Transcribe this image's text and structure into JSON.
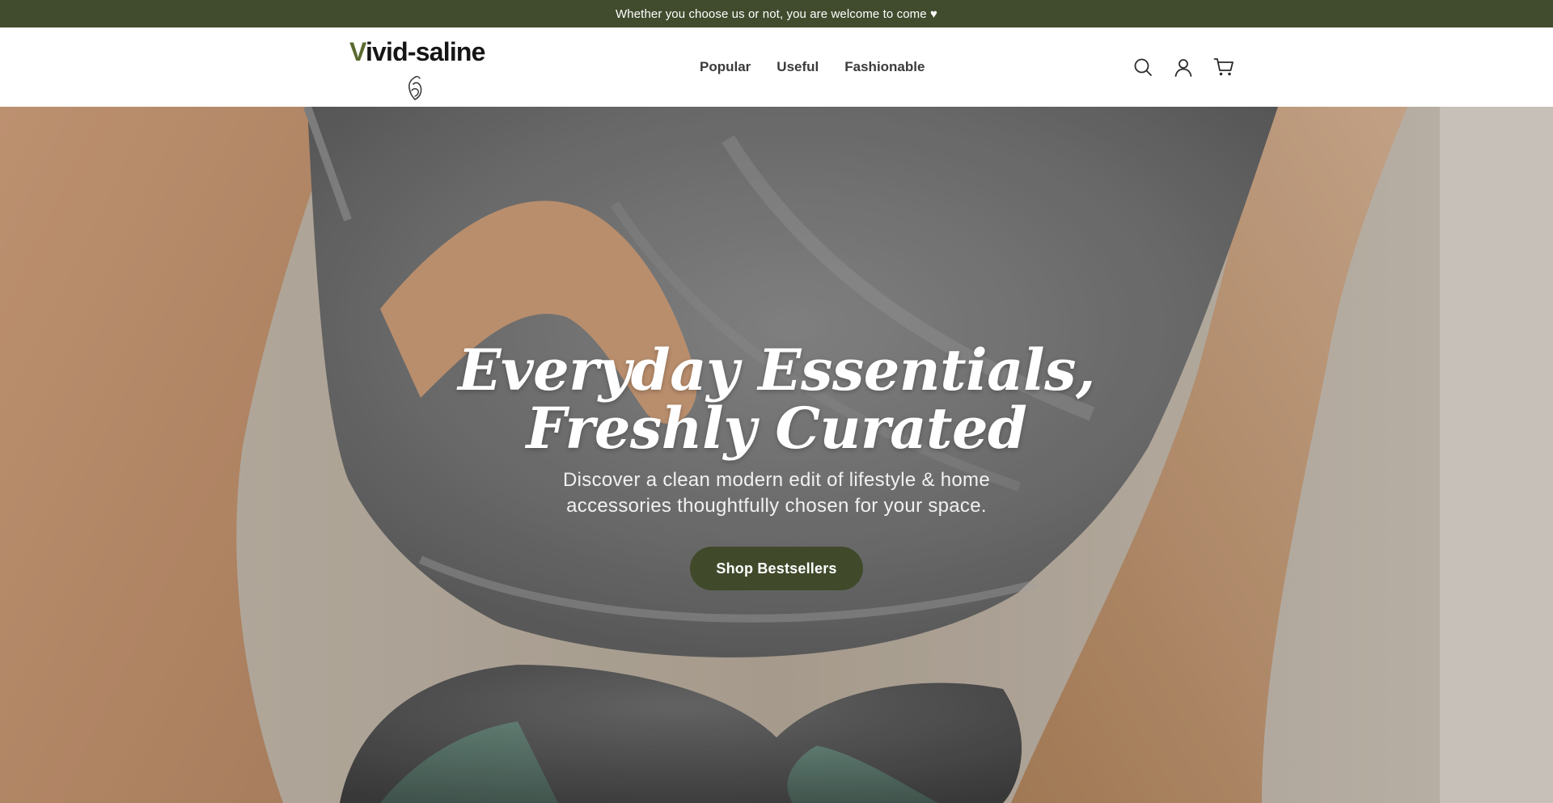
{
  "announcement": {
    "text": "Whether you choose us or not, you are welcome to come ♥"
  },
  "header": {
    "logo": {
      "first_letter": "V",
      "rest": "ivid-saline"
    },
    "nav": [
      {
        "label": "Popular"
      },
      {
        "label": "Useful"
      },
      {
        "label": "Fashionable"
      }
    ],
    "icons": [
      "search-icon",
      "account-icon",
      "cart-icon"
    ]
  },
  "hero": {
    "title_line1": "Everyday Essentials,",
    "title_line2": "Freshly Curated",
    "subtitle": "Discover a clean modern edit of lifestyle & home accessories thoughtfully chosen for your space.",
    "cta_label": "Shop Bestsellers"
  },
  "colors": {
    "announcement_bg": "#414c2e",
    "button_bg": "#404a2b",
    "text_dark": "#3b3b3b"
  }
}
